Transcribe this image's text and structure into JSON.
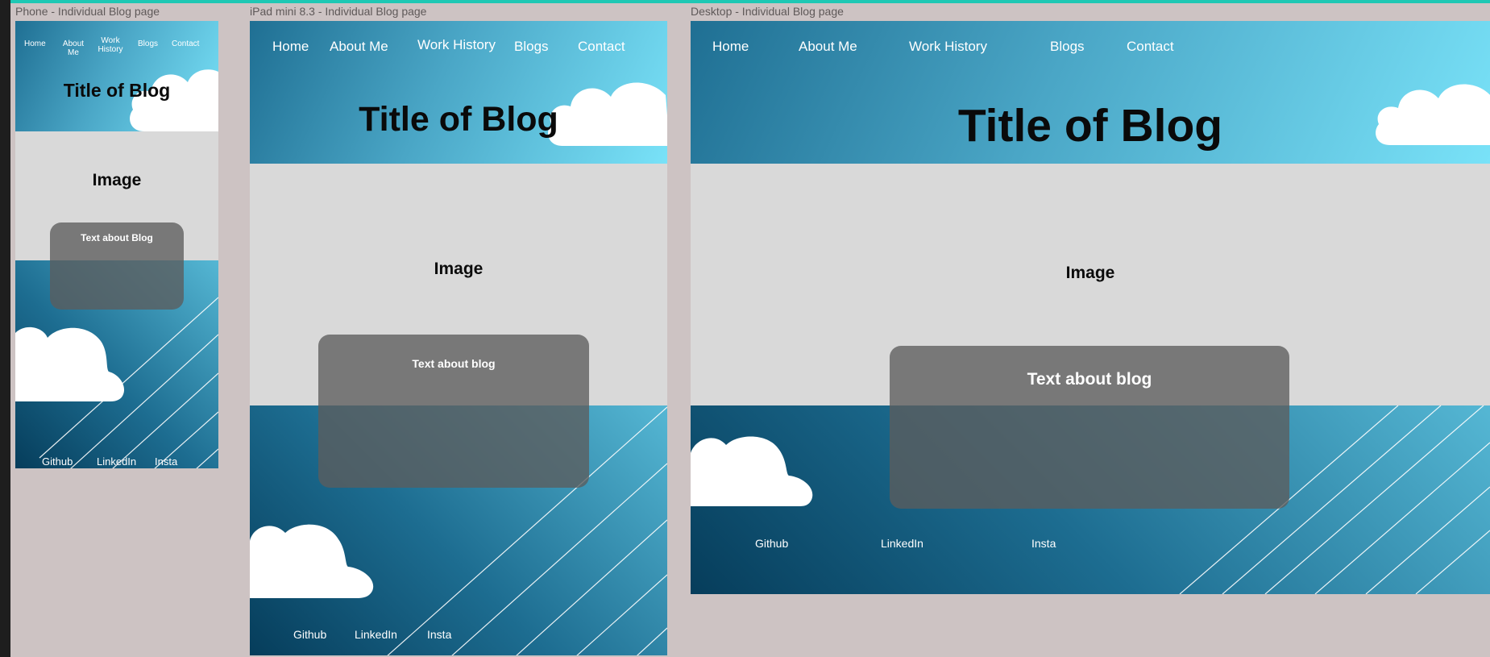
{
  "frames": {
    "phone": {
      "label": "Phone - Individual Blog page",
      "nav": {
        "home": "Home",
        "about": "About Me",
        "work": "Work History",
        "blogs": "Blogs",
        "contact": "Contact"
      },
      "title": "Title of Blog",
      "image_label": "Image",
      "text_box": "Text about Blog",
      "footer": {
        "github": "Github",
        "linkedin": "LinkedIn",
        "insta": "Insta"
      }
    },
    "ipad": {
      "label": "iPad mini 8.3 - Individual Blog page",
      "nav": {
        "home": "Home",
        "about": "About Me",
        "work": "Work History",
        "blogs": "Blogs",
        "contact": "Contact"
      },
      "title": "Title of Blog",
      "image_label": "Image",
      "text_box": "Text about blog",
      "footer": {
        "github": "Github",
        "linkedin": "LinkedIn",
        "insta": "Insta"
      }
    },
    "desktop": {
      "label": "Desktop - Individual Blog page",
      "nav": {
        "home": "Home",
        "about": "About Me",
        "work": "Work History",
        "blogs": "Blogs",
        "contact": "Contact"
      },
      "title": "Title of Blog",
      "image_label": "Image",
      "text_box": "Text about blog",
      "footer": {
        "github": "Github",
        "linkedin": "LinkedIn",
        "insta": "Insta"
      }
    }
  },
  "icons": {
    "cloud": "cloud-icon",
    "diagonal_lines": "diagonal-lines-decoration"
  },
  "colors": {
    "canvas": "#cdc3c3",
    "header_gradient": [
      "#1f6f93",
      "#79e2f8"
    ],
    "footer_gradient": [
      "#063d5b",
      "#55b7d4"
    ],
    "image_placeholder": "#d9d9d9",
    "text_box": "#5c5c5c"
  }
}
